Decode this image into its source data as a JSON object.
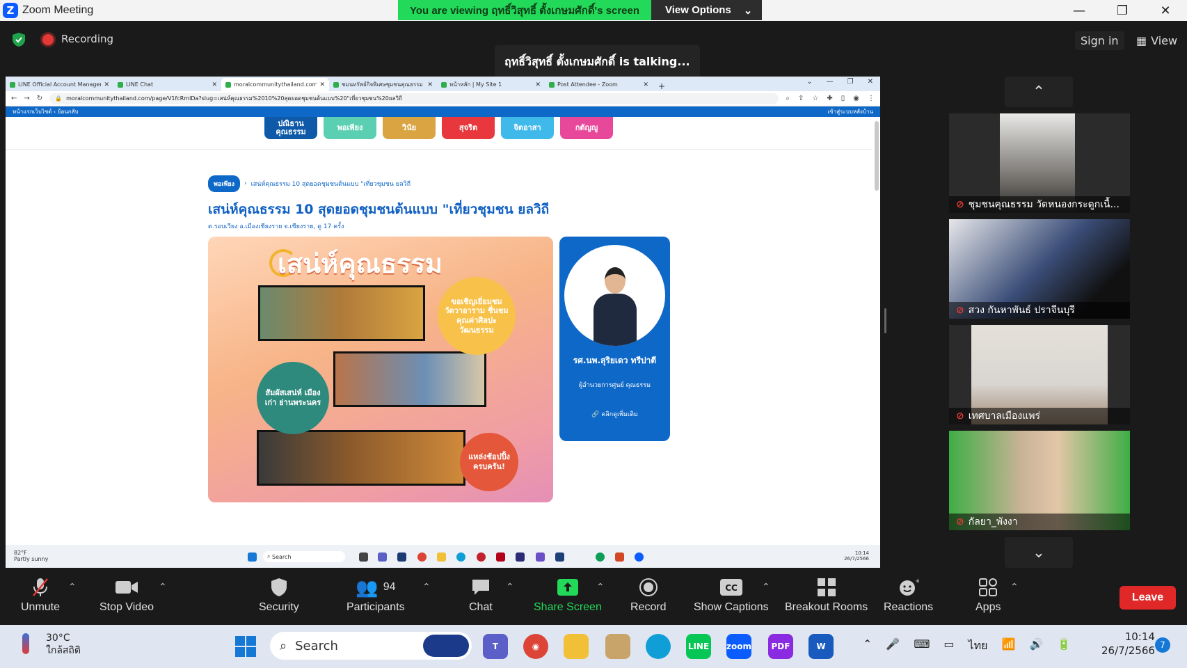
{
  "window": {
    "app_title": "Zoom Meeting",
    "viewing_banner": "You are viewing ฤทธิ์วิสุทธิ์ ตั้งเกษมศักดิ์'s screen",
    "view_options": "View Options"
  },
  "topbar": {
    "recording": "Recording",
    "talking": "ฤทธิ์วิสุทธิ์ ตั้งเกษมศักดิ์ is talking...",
    "sign_in": "Sign in",
    "view": "View"
  },
  "shared_screen": {
    "browser_tabs": [
      {
        "title": "LINE Official Account Manager",
        "active": false
      },
      {
        "title": "LINE Chat",
        "active": false
      },
      {
        "title": "moralcommunitythailand.com/p",
        "active": true
      },
      {
        "title": "ชมนทรัพย์กิจพิเศษชุมชนคุณธรรม",
        "active": false
      },
      {
        "title": "หน้าหลัก | My Site 1",
        "active": false
      },
      {
        "title": "Post Attendee - Zoom",
        "active": false
      }
    ],
    "url": "moralcommunitythailand.com/page/V1fcRmlDa?slug=เสน่ห์คุณธรรม%2010%20สุดยอดชุมชนต้นแบบ%20\"เที่ยวชุมชน%20ยลวิถี",
    "site_nav_left": "หน้าแรกเว็บไซต์  ‹ ย้อนกลับ",
    "site_nav_right": "เข้าสู่ระบบหลังบ้าน",
    "categories": [
      {
        "label": "ปณิธาน คุณธรรม",
        "color": "#0e5aa8"
      },
      {
        "label": "พอเพียง",
        "color": "#5bcfb2"
      },
      {
        "label": "วินัย",
        "color": "#d9a441"
      },
      {
        "label": "สุจริต",
        "color": "#e8383d"
      },
      {
        "label": "จิตอาสา",
        "color": "#3fb8ea"
      },
      {
        "label": "กตัญญู",
        "color": "#e8489a"
      }
    ],
    "breadcrumb_pill": "พอเพียง",
    "breadcrumb_path": "เสน่ห์คุณธรรม 10 สุดยอดชุมชนต้นแบบ \"เที่ยวชุมชน ยลวิถี",
    "article_title": "เสน่ห์คุณธรรม 10 สุดยอดชุมชนต้นแบบ \"เที่ยวชุมชน ยลวิถี",
    "article_meta": "ต.รอบเวียง อ.เมืองเชียงราย จ.เชียงราย,  ดู 17 ครั้ง",
    "poster": {
      "headline": "เสน่ห์คุณธรรม",
      "bubble_1": "ขอเชิญเยี่ยมชม วัดวาอาราม ชื่นชมคุณค่าศิลปะ วัฒนธรรม",
      "bubble_2": "สัมผัสเสน่ห์ เมืองเก่า ย่านพระนคร",
      "bubble_3": "แหล่งช้อปปิ้ง ครบครัน!"
    },
    "profile": {
      "name": "รศ.นพ.สุริยเดว ทรีปาตี",
      "role": "ผู้อำนวยการศูนย์ คุณธรรม",
      "link": "คลิกดูเพิ่มเติม"
    },
    "inner_taskbar": {
      "weather_temp": "82°F",
      "weather_desc": "Partly sunny",
      "search": "Search",
      "time": "10:14",
      "date": "26/7/2566"
    }
  },
  "gallery": {
    "participants": [
      {
        "name": "ชุมชนคุณธรรม วัดหนองกระดูกเนื้...",
        "muted": true,
        "bg": "#6d6a66"
      },
      {
        "name": "สวง กันหาพันธ์ ปราจีนบุรี",
        "muted": true,
        "bg": "#3b4e78"
      },
      {
        "name": "เทศบาลเมืองแพร่",
        "muted": true,
        "bg": "#d8d4cf"
      },
      {
        "name": "กัลยา_พังงา",
        "muted": true,
        "bg": "#3fae45"
      }
    ]
  },
  "toolbar": {
    "unmute": "Unmute",
    "stop_video": "Stop Video",
    "security": "Security",
    "participants": "Participants",
    "participants_count": "94",
    "chat": "Chat",
    "share_screen": "Share Screen",
    "record": "Record",
    "show_captions": "Show Captions",
    "breakout_rooms": "Breakout Rooms",
    "reactions": "Reactions",
    "apps": "Apps",
    "leave": "Leave"
  },
  "taskbar": {
    "temp": "30°C",
    "weather": "ใกล้สถิติ",
    "search": "Search",
    "lang": "ไทย",
    "time": "10:14",
    "date": "26/7/2566",
    "notifications": "7"
  }
}
